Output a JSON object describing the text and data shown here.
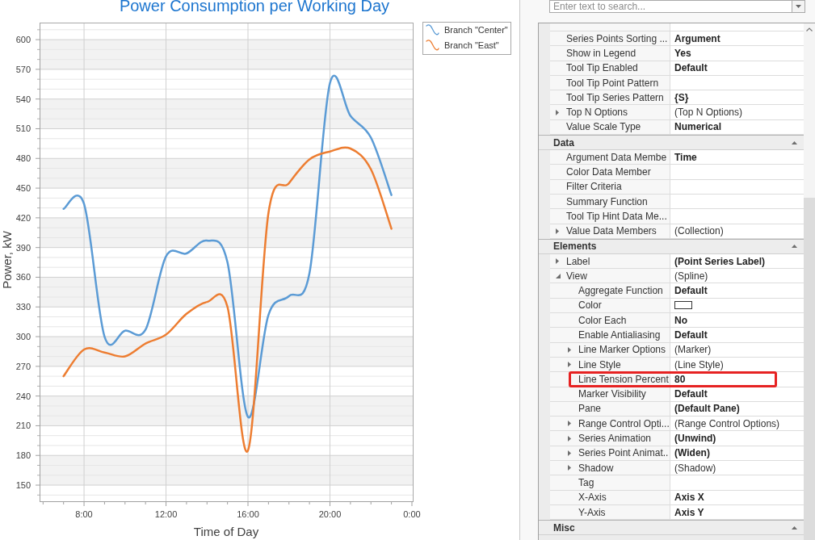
{
  "chart": {
    "chart_data": {
      "type": "line",
      "title": "Power Consumption per Working Day",
      "xlabel": "Time of Day",
      "ylabel": "Power, kW",
      "x": [
        7,
        8,
        9,
        10,
        11,
        12,
        13,
        14,
        15,
        16,
        17,
        18,
        19,
        20,
        21,
        22,
        23
      ],
      "series": [
        {
          "name": "Branch \"Center\"",
          "color": "#5b9bd5",
          "values": [
            429,
            434,
            300,
            306,
            307,
            381,
            384,
            397,
            375,
            219,
            322,
            341,
            364,
            556,
            523,
            501,
            443
          ]
        },
        {
          "name": "Branch \"East\"",
          "color": "#ed7d31",
          "values": [
            260,
            287,
            284,
            280,
            293,
            302,
            323,
            335,
            330,
            185,
            425,
            455,
            479,
            487,
            490,
            469,
            409
          ]
        }
      ],
      "xlim": [
        5.83,
        24.08
      ],
      "ylim": [
        132.9,
        617.2
      ],
      "xticks": [
        {
          "value": 8,
          "label": "8:00"
        },
        {
          "value": 12,
          "label": "12:00"
        },
        {
          "value": 16,
          "label": "16:00"
        },
        {
          "value": 20,
          "label": "20:00"
        },
        {
          "value": 24,
          "label": "0:00"
        }
      ],
      "yticks": [
        150,
        180,
        210,
        240,
        270,
        300,
        330,
        360,
        390,
        420,
        450,
        480,
        510,
        540,
        570,
        600
      ],
      "grid": true,
      "legend": true
    }
  },
  "property_panel": {
    "search": {
      "placeholder": "Enter text to search..."
    },
    "sections": [
      {
        "rows": [
          {
            "name": "Series Points Sorting ...",
            "value": "Argument",
            "value_bold": true,
            "expandable": false,
            "kind": "text",
            "highlighted": false
          },
          {
            "name": "Show in Legend",
            "value": "Yes",
            "value_bold": true,
            "expandable": false,
            "kind": "text",
            "highlighted": false
          },
          {
            "name": "Tool Tip Enabled",
            "value": "Default",
            "value_bold": true,
            "expandable": false,
            "kind": "text",
            "highlighted": false
          },
          {
            "name": "Tool Tip Point Pattern",
            "expandable": false,
            "kind": "text",
            "highlighted": false
          },
          {
            "name": "Tool Tip Series Pattern",
            "value": "{S}",
            "value_bold": true,
            "expandable": false,
            "kind": "text",
            "highlighted": false
          },
          {
            "name": "Top N Options",
            "value": "(Top N Options)",
            "value_bold": false,
            "expandable": true,
            "expanded": false,
            "kind": "text",
            "highlighted": false
          },
          {
            "name": "Value Scale Type",
            "value": "Numerical",
            "value_bold": true,
            "expandable": false,
            "kind": "text",
            "highlighted": false
          }
        ]
      },
      {
        "title": "Data",
        "expanded": true,
        "rows": [
          {
            "name": "Argument Data Membe",
            "value": "Time",
            "value_bold": true,
            "expandable": false,
            "kind": "text",
            "highlighted": false
          },
          {
            "name": "Color Data Member",
            "expandable": false,
            "kind": "text",
            "highlighted": false
          },
          {
            "name": "Filter Criteria",
            "expandable": false,
            "kind": "text",
            "highlighted": false
          },
          {
            "name": "Summary Function",
            "expandable": false,
            "kind": "text",
            "highlighted": false
          },
          {
            "name": "Tool Tip Hint Data Me...",
            "expandable": false,
            "kind": "text",
            "highlighted": false
          },
          {
            "name": "Value Data Members",
            "value": "(Collection)",
            "value_bold": false,
            "expandable": true,
            "expanded": false,
            "kind": "text",
            "highlighted": false
          }
        ]
      },
      {
        "title": "Elements",
        "expanded": true,
        "rows": [
          {
            "name": "Label",
            "value": "(Point Series Label)",
            "value_bold": true,
            "expandable": true,
            "expanded": false,
            "kind": "text",
            "highlighted": false
          },
          {
            "name": "View",
            "value": "(Spline)",
            "value_bold": false,
            "expandable": true,
            "expanded": true,
            "kind": "text",
            "highlighted": false,
            "children": [
              {
                "name": "Aggregate Function",
                "value": "Default",
                "value_bold": true,
                "expandable": false,
                "kind": "text",
                "highlighted": false
              },
              {
                "name": "Color",
                "color": "#ffffff",
                "expandable": false,
                "kind": "color",
                "highlighted": false
              },
              {
                "name": "Color Each",
                "value": "No",
                "value_bold": true,
                "expandable": false,
                "kind": "text",
                "highlighted": false
              },
              {
                "name": "Enable Antialiasing",
                "value": "Default",
                "value_bold": true,
                "expandable": false,
                "kind": "text",
                "highlighted": false
              },
              {
                "name": "Line Marker Options",
                "value": "(Marker)",
                "value_bold": false,
                "expandable": true,
                "expanded": false,
                "kind": "text",
                "highlighted": false
              },
              {
                "name": "Line Style",
                "value": "(Line Style)",
                "value_bold": false,
                "expandable": true,
                "expanded": false,
                "kind": "text",
                "highlighted": false
              },
              {
                "name": "Line Tension Percent",
                "value": "80",
                "value_bold": true,
                "expandable": false,
                "kind": "text",
                "highlighted": true
              },
              {
                "name": "Marker Visibility",
                "value": "Default",
                "value_bold": true,
                "expandable": false,
                "kind": "text",
                "highlighted": false
              },
              {
                "name": "Pane",
                "value": "(Default Pane)",
                "value_bold": true,
                "expandable": false,
                "kind": "text",
                "highlighted": false
              },
              {
                "name": "Range Control Opti...",
                "value": "(Range Control Options)",
                "value_bold": false,
                "expandable": true,
                "expanded": false,
                "kind": "text",
                "highlighted": false
              },
              {
                "name": "Series Animation",
                "value": "(Unwind)",
                "value_bold": true,
                "expandable": true,
                "expanded": false,
                "kind": "text",
                "highlighted": false
              },
              {
                "name": "Series Point Animat..",
                "value": "(Widen)",
                "value_bold": true,
                "expandable": true,
                "expanded": false,
                "kind": "text",
                "highlighted": false
              },
              {
                "name": "Shadow",
                "value": "(Shadow)",
                "value_bold": false,
                "expandable": true,
                "expanded": false,
                "kind": "text",
                "highlighted": false
              },
              {
                "name": "Tag",
                "expandable": false,
                "kind": "text",
                "highlighted": false
              },
              {
                "name": "X-Axis",
                "value": "Axis X",
                "value_bold": true,
                "expandable": false,
                "kind": "text",
                "highlighted": false
              },
              {
                "name": "Y-Axis",
                "value": "Axis Y",
                "value_bold": true,
                "expandable": false,
                "kind": "text",
                "highlighted": false
              }
            ]
          }
        ]
      },
      {
        "title": "Misc",
        "expanded": true
      }
    ]
  }
}
